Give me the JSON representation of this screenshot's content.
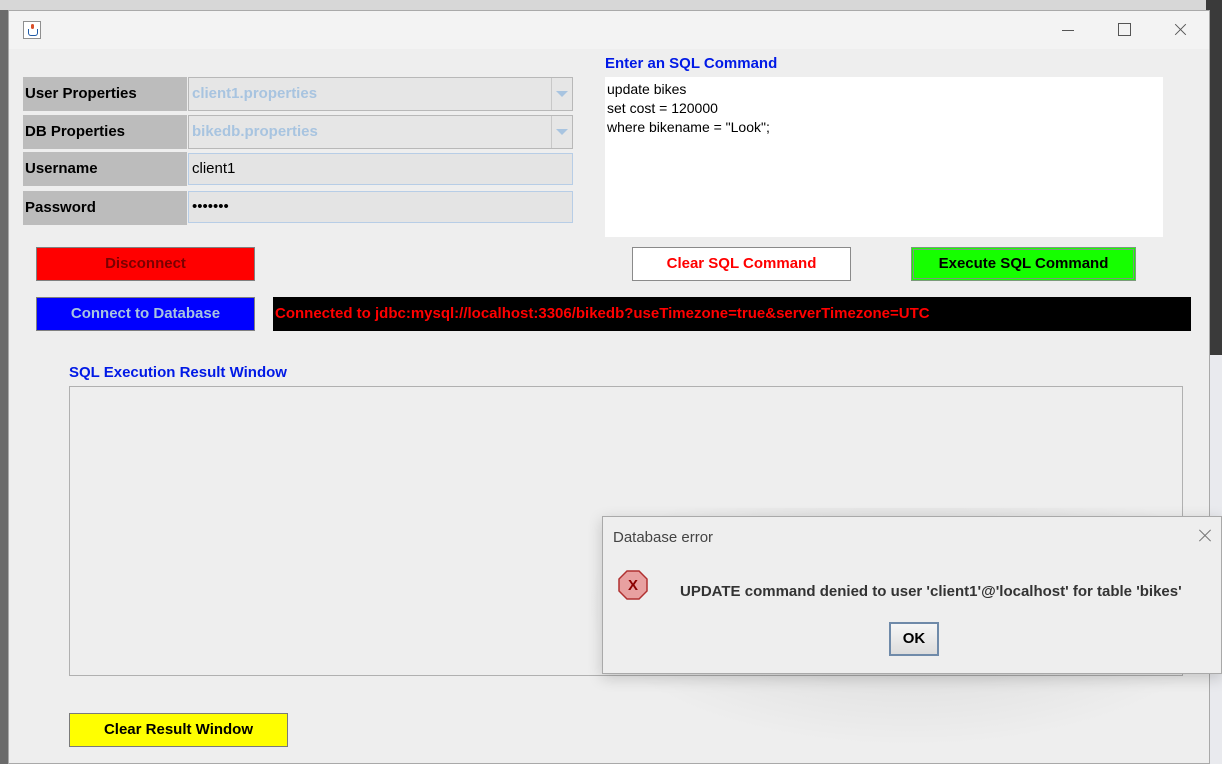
{
  "window": {
    "title": ""
  },
  "form": {
    "user_properties_label": "User Properties",
    "user_properties_value": "client1.properties",
    "db_properties_label": "DB Properties",
    "db_properties_value": "bikedb.properties",
    "username_label": "Username",
    "username_value": "client1",
    "password_label": "Password",
    "password_value": "•••••••"
  },
  "sql": {
    "title": "Enter an SQL Command",
    "command": "update bikes\nset cost = 120000\nwhere bikename = \"Look\";"
  },
  "buttons": {
    "disconnect": "Disconnect",
    "clear_sql": "Clear SQL Command",
    "execute_sql": "Execute SQL Command",
    "connect": "Connect to Database",
    "clear_result": "Clear Result Window"
  },
  "status": {
    "text": "Connected to jdbc:mysql://localhost:3306/bikedb?useTimezone=true&serverTimezone=UTC"
  },
  "result": {
    "title": "SQL Execution Result Window"
  },
  "dialog": {
    "title": "Database error",
    "message": "UPDATE command denied to user 'client1'@'localhost' for table 'bikes'",
    "ok_label": "OK"
  },
  "colors": {
    "disconnect_bg": "#ff0000",
    "execute_bg": "#16ff00",
    "connect_bg": "#0000ff",
    "clear_result_bg": "#ffff00",
    "status_text": "#ff0000",
    "section_title": "#0019e6"
  }
}
